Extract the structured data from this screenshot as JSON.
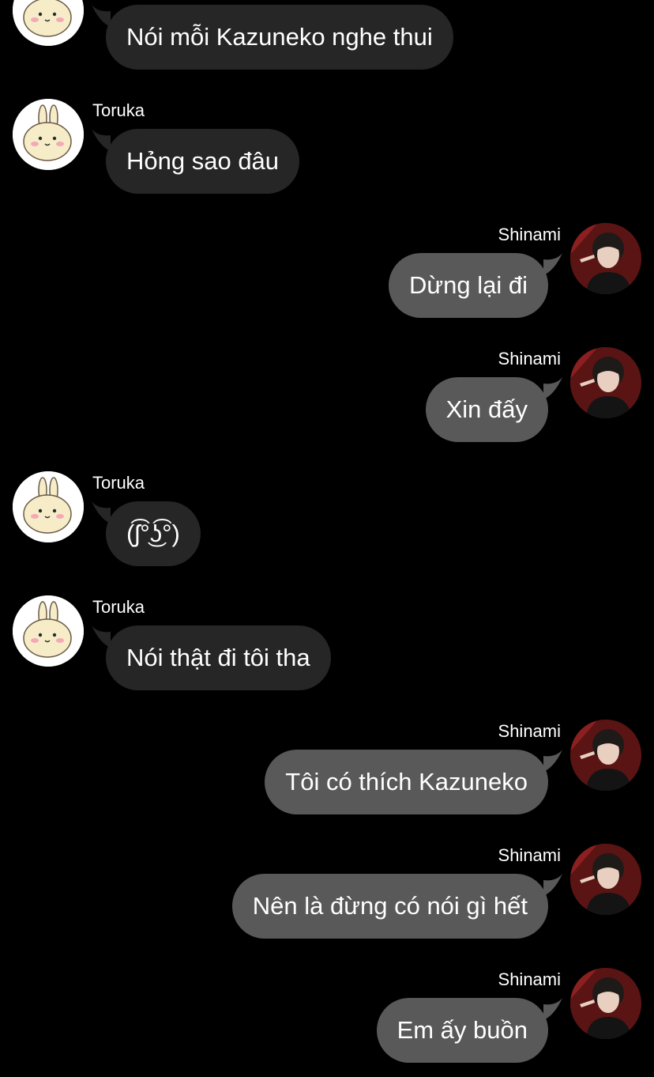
{
  "colors": {
    "background": "#000000",
    "incoming_bubble": "#262626",
    "outgoing_bubble": "#595959",
    "text": "#ffffff"
  },
  "messages": [
    {
      "side": "left",
      "sender": "",
      "avatar": "bunny-avatar-icon",
      "text": "Nói mỗi Kazuneko nghe thui"
    },
    {
      "side": "left",
      "sender": "Toruka",
      "avatar": "bunny-avatar-icon",
      "text": "Hỏng sao đâu"
    },
    {
      "side": "right",
      "sender": "Shinami",
      "avatar": "person-avatar-icon",
      "text": "Dừng lại đi"
    },
    {
      "side": "right",
      "sender": "Shinami",
      "avatar": "person-avatar-icon",
      "text": "Xin đấy"
    },
    {
      "side": "left",
      "sender": "Toruka",
      "avatar": "bunny-avatar-icon",
      "text": "(ʃ͡°͜ʖ͡°)"
    },
    {
      "side": "left",
      "sender": "Toruka",
      "avatar": "bunny-avatar-icon",
      "text": "Nói thật đi tôi tha"
    },
    {
      "side": "right",
      "sender": "Shinami",
      "avatar": "person-avatar-icon",
      "text": "Tôi có thích Kazuneko"
    },
    {
      "side": "right",
      "sender": "Shinami",
      "avatar": "person-avatar-icon",
      "text": "Nên là đừng có nói gì hết"
    },
    {
      "side": "right",
      "sender": "Shinami",
      "avatar": "person-avatar-icon",
      "text": "Em ấy buồn"
    }
  ]
}
